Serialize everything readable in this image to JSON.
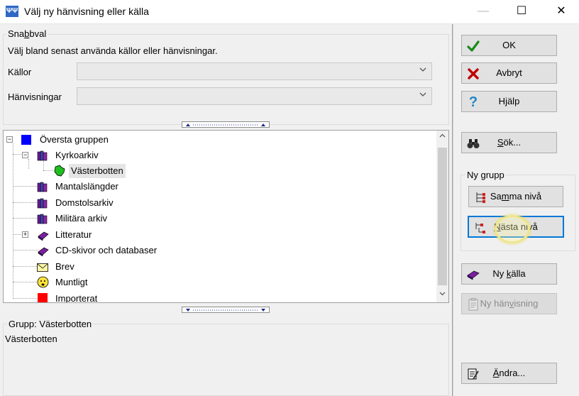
{
  "window": {
    "title": "Välj ny hänvisning eller källa",
    "app_icon_glyph": "ΨΨ",
    "minimize": "—",
    "maximize": "☐",
    "close": "✕"
  },
  "recent": {
    "title_pre": "Sna",
    "title_u": "b",
    "title_post": "bval",
    "description": "Välj bland senast använda källor eller hänvisningar.",
    "sources_label": "Källor",
    "sources_value": "",
    "references_label": "Hänvisningar",
    "references_value": ""
  },
  "tree": {
    "items": [
      {
        "label": "Översta gruppen"
      },
      {
        "label": "Kyrkoarkiv"
      },
      {
        "label": "Västerbotten"
      },
      {
        "label": "Mantalslängder"
      },
      {
        "label": "Domstolsarkiv"
      },
      {
        "label": "Militära arkiv"
      },
      {
        "label": "Litteratur"
      },
      {
        "label": "CD-skivor och databaser"
      },
      {
        "label": "Brev"
      },
      {
        "label": "Muntligt"
      },
      {
        "label": "Importerat"
      }
    ]
  },
  "detail": {
    "group_title": "Grupp: Västerbotten",
    "text": "Västerbotten"
  },
  "buttons": {
    "ok": "OK",
    "cancel": "Avbryt",
    "help_pre": "H",
    "help_u": "j",
    "help_post": "älp",
    "search_u": "S",
    "search_post": "ök...",
    "new_group_title": "Ny grupp",
    "same_level_pre": "Sa",
    "same_level_u": "m",
    "same_level_post": "ma nivå",
    "next_level_u": "N",
    "next_level_post": "ästa nivå",
    "new_source_pre": "Ny ",
    "new_source_u": "k",
    "new_source_post": "älla",
    "new_reference_pre": "Ny hän",
    "new_reference_u": "v",
    "new_reference_post": "isning",
    "edit_u": "Ä",
    "edit_post": "ndra..."
  },
  "colors": {
    "accent": "#0078d7",
    "top_group_square": "#0000ff",
    "imported_square": "#ff0000",
    "highlight": "#f0e68c"
  }
}
